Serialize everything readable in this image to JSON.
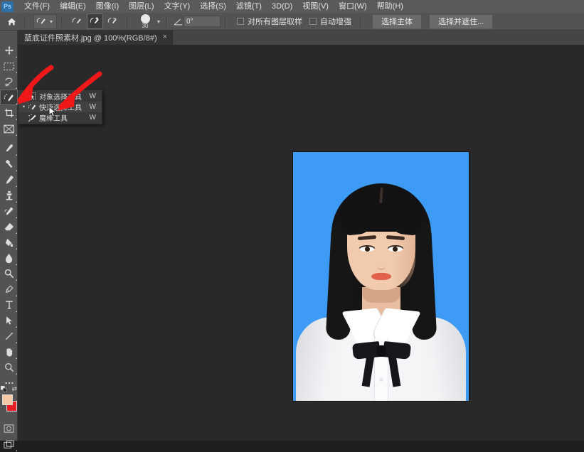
{
  "app": {
    "name": "Adobe Photoshop",
    "logo_text": "Ps",
    "theme_bg": "#2b2b2b",
    "accent": "#2e6fa8"
  },
  "menubar": {
    "items": [
      {
        "label": "文件(F)",
        "name": "menu-file"
      },
      {
        "label": "编辑(E)",
        "name": "menu-edit"
      },
      {
        "label": "图像(I)",
        "name": "menu-image"
      },
      {
        "label": "图层(L)",
        "name": "menu-layer"
      },
      {
        "label": "文字(Y)",
        "name": "menu-type"
      },
      {
        "label": "选择(S)",
        "name": "menu-select"
      },
      {
        "label": "滤镜(T)",
        "name": "menu-filter"
      },
      {
        "label": "3D(D)",
        "name": "menu-3d"
      },
      {
        "label": "视图(V)",
        "name": "menu-view"
      },
      {
        "label": "窗口(W)",
        "name": "menu-window"
      },
      {
        "label": "帮助(H)",
        "name": "menu-help"
      }
    ]
  },
  "optionsbar": {
    "home_icon": "home-icon",
    "tool_preset_icon": "quick-selection-tool-icon",
    "modes": [
      {
        "name": "new-selection-mode",
        "active": false
      },
      {
        "name": "add-to-selection-mode",
        "active": true
      },
      {
        "name": "subtract-from-selection-mode",
        "active": false
      }
    ],
    "brush_size": "30",
    "angle_label": "angle-icon",
    "angle_value": "0°",
    "checkboxes": [
      {
        "label": "对所有图层取样",
        "checked": false,
        "name": "sample-all-layers-checkbox"
      },
      {
        "label": "自动增强",
        "checked": false,
        "name": "auto-enhance-checkbox"
      }
    ],
    "buttons": [
      {
        "label": "选择主体",
        "name": "select-subject-button"
      },
      {
        "label": "选择并遮住...",
        "name": "select-and-mask-button"
      }
    ]
  },
  "tabbar": {
    "tab_title": "蓝底证件照素材.jpg @ 100%(RGB/8#)",
    "close_glyph": "×"
  },
  "toolbar": {
    "tools": [
      {
        "name": "move-tool",
        "icon": "move-icon",
        "selected": false
      },
      {
        "name": "rectangular-marquee-tool",
        "icon": "marquee-icon",
        "selected": false
      },
      {
        "name": "lasso-tool",
        "icon": "lasso-icon",
        "selected": false
      },
      {
        "name": "quick-selection-tool",
        "icon": "quick-selection-icon",
        "selected": true
      },
      {
        "name": "crop-tool",
        "icon": "crop-icon",
        "selected": false
      },
      {
        "name": "frame-tool",
        "icon": "frame-icon",
        "selected": false
      },
      {
        "name": "eyedropper-tool",
        "icon": "eyedropper-icon",
        "selected": false
      },
      {
        "name": "spot-healing-brush-tool",
        "icon": "healing-brush-icon",
        "selected": false
      },
      {
        "name": "brush-tool",
        "icon": "brush-icon",
        "selected": false
      },
      {
        "name": "clone-stamp-tool",
        "icon": "clone-stamp-icon",
        "selected": false
      },
      {
        "name": "history-brush-tool",
        "icon": "history-brush-icon",
        "selected": false
      },
      {
        "name": "eraser-tool",
        "icon": "eraser-icon",
        "selected": false
      },
      {
        "name": "gradient-tool",
        "icon": "paint-bucket-icon",
        "selected": false
      },
      {
        "name": "blur-tool",
        "icon": "blur-drop-icon",
        "selected": false
      },
      {
        "name": "dodge-tool",
        "icon": "dodge-icon",
        "selected": false
      },
      {
        "name": "pen-tool",
        "icon": "pen-icon",
        "selected": false
      },
      {
        "name": "horizontal-type-tool",
        "icon": "type-icon",
        "selected": false
      },
      {
        "name": "path-selection-tool",
        "icon": "path-arrow-icon",
        "selected": false
      },
      {
        "name": "line-tool",
        "icon": "line-shape-icon",
        "selected": false
      },
      {
        "name": "hand-tool",
        "icon": "hand-icon",
        "selected": false
      },
      {
        "name": "zoom-tool",
        "icon": "magnifier-icon",
        "selected": false
      },
      {
        "name": "edit-toolbar-button",
        "icon": "ellipsis-icon",
        "selected": false
      }
    ],
    "foreground_color": "#f6c9a4",
    "background_color": "#ea1c24",
    "swap_icon": "swap-colors-icon",
    "reset_icon": "default-colors-icon",
    "bottom_tools": [
      {
        "name": "quick-mask-button",
        "icon": "quick-mask-icon"
      },
      {
        "name": "screen-mode-button",
        "icon": "screen-mode-icon"
      }
    ]
  },
  "flyout": {
    "items": [
      {
        "label": "对象选择工具",
        "shortcut": "W",
        "icon": "object-selection-icon",
        "current": false,
        "name": "flyout-object-selection-tool"
      },
      {
        "label": "快速选择工具",
        "shortcut": "W",
        "icon": "quick-selection-icon",
        "current": true,
        "name": "flyout-quick-selection-tool"
      },
      {
        "label": "魔棒工具",
        "shortcut": "W",
        "icon": "magic-wand-icon",
        "current": false,
        "name": "flyout-magic-wand-tool"
      }
    ]
  },
  "canvas": {
    "document_background": "#292929",
    "photo": {
      "backdrop_color": "#3d9bf5",
      "subject": "id-photo-portrait",
      "shirt_color": "#ffffff",
      "bowtie_color": "#16181d",
      "hair_color": "#141414"
    }
  },
  "annotations": {
    "arrow_color": "#f01818",
    "arrows": [
      {
        "name": "annotation-arrow-toolbar",
        "points_to": "quick-selection-tool"
      },
      {
        "name": "annotation-arrow-flyout",
        "points_to": "flyout-quick-selection-tool"
      }
    ],
    "cursor": "mouse-pointer-icon"
  }
}
